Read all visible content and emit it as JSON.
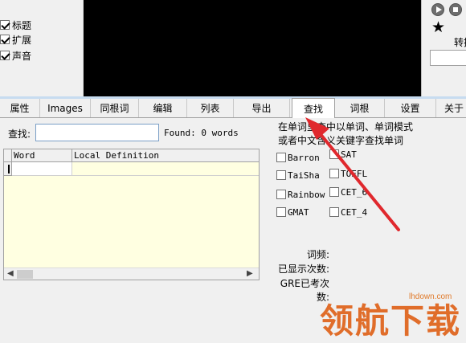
{
  "options_left": [
    {
      "label": "标题",
      "checked": true
    },
    {
      "label": "扩展",
      "checked": true
    },
    {
      "label": "声音",
      "checked": true
    }
  ],
  "right_panel": {
    "star": "★",
    "convert_label": "转换"
  },
  "tabs": [
    {
      "label": "属性",
      "active": false
    },
    {
      "label": "Images",
      "active": false
    },
    {
      "label": "同根词",
      "active": false
    },
    {
      "label": "编辑",
      "active": false
    },
    {
      "label": "列表",
      "active": false
    },
    {
      "label": "导出",
      "active": false
    },
    {
      "label": "查找",
      "active": true
    },
    {
      "label": "词根",
      "active": false
    },
    {
      "label": "设置",
      "active": false
    },
    {
      "label": "关于",
      "active": false
    }
  ],
  "search": {
    "label": "查找:",
    "value": "",
    "found_text": "Found: 0 words"
  },
  "grid": {
    "columns": [
      "Word",
      "Local Definition"
    ],
    "rows": []
  },
  "description": {
    "line1": "在单词里查中以单词、单词模式",
    "line2": "或者中文含义关键字查找单词"
  },
  "word_lists": [
    {
      "label": "Barron",
      "checked": false
    },
    {
      "label": "SAT",
      "checked": false
    },
    {
      "label": "TaiSha",
      "checked": false
    },
    {
      "label": "TOEFL",
      "checked": false
    },
    {
      "label": "Rainbow",
      "checked": false
    },
    {
      "label": "CET_6",
      "checked": false
    },
    {
      "label": "GMAT",
      "checked": false
    },
    {
      "label": "CET_4",
      "checked": false
    }
  ],
  "stats": {
    "frequency": "词频:",
    "shown_count": "已显示次数:",
    "gre_count": "GRE已考次数:"
  },
  "watermark": {
    "text": "领航下载",
    "url": "lhdown.com"
  },
  "colors": {
    "grid_bg": "#ffffe1",
    "annotation_arrow": "#e0282d",
    "watermark": "#e06d2a"
  }
}
